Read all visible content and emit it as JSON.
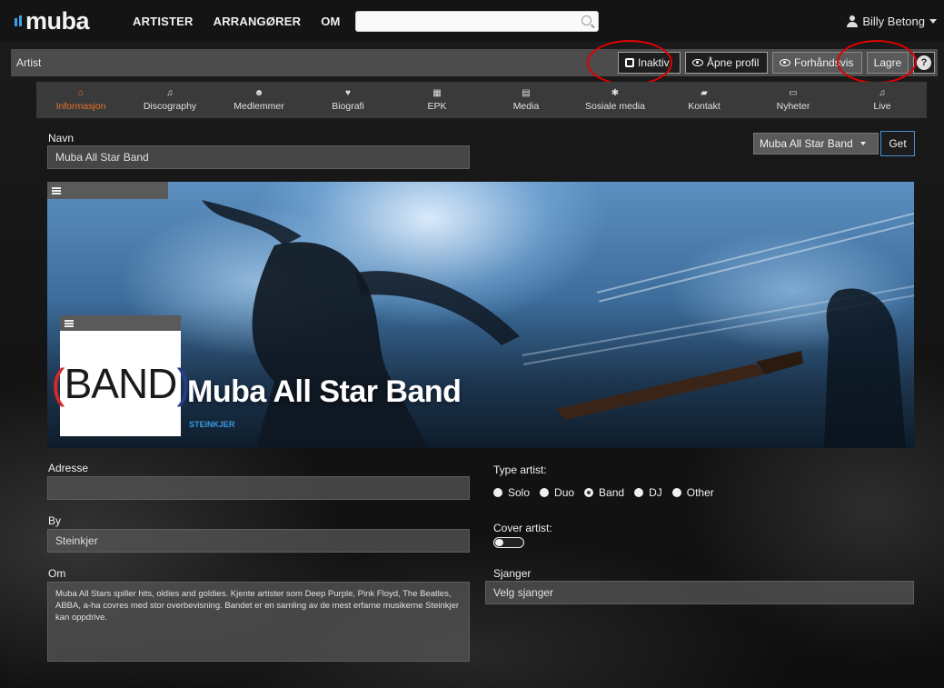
{
  "nav": {
    "logo": "muba",
    "links": [
      "ARTISTER",
      "ARRANGØRER",
      "OM"
    ],
    "search_placeholder": "",
    "user": "Billy Betong"
  },
  "header": {
    "title": "Artist",
    "actions": {
      "inactive": "Inaktiv",
      "open_profile": "Åpne profil",
      "preview": "Forhåndsvis",
      "save": "Lagre",
      "help": "?"
    }
  },
  "tabs": [
    {
      "label": "Informasjon",
      "icon": "home-icon",
      "glyph": "⌂",
      "active": true
    },
    {
      "label": "Discography",
      "icon": "music-icon",
      "glyph": "♫"
    },
    {
      "label": "Medlemmer",
      "icon": "users-icon",
      "glyph": "☻"
    },
    {
      "label": "Biografi",
      "icon": "heart-icon",
      "glyph": "♥"
    },
    {
      "label": "EPK",
      "icon": "calendar-icon",
      "glyph": "▦"
    },
    {
      "label": "Media",
      "icon": "file-icon",
      "glyph": "▤"
    },
    {
      "label": "Sosiale media",
      "icon": "gear-icon",
      "glyph": "✱"
    },
    {
      "label": "Kontakt",
      "icon": "book-icon",
      "glyph": "▰"
    },
    {
      "label": "Nyheter",
      "icon": "newspaper-icon",
      "glyph": "▭"
    },
    {
      "label": "Live",
      "icon": "music-icon",
      "glyph": "♫"
    }
  ],
  "form": {
    "name_label": "Navn",
    "name_value": "Muba All Star Band",
    "artist_select": "Muba All Star Band",
    "get_button": "Get",
    "address_label": "Adresse",
    "address_value": "",
    "city_label": "By",
    "city_value": "Steinkjer",
    "about_label": "Om",
    "about_value": "Muba All Stars spiller hits, oldies and goldies. Kjente artister som Deep Purple, Pink Floyd, The Beatles, ABBA, a-ha covres med stor overbevisning. Bandet er en samling av de mest erfarne musikerne Steinkjer kan oppdrive.",
    "type_label": "Type artist:",
    "types": [
      {
        "label": "Solo",
        "checked": false
      },
      {
        "label": "Duo",
        "checked": false
      },
      {
        "label": "Band",
        "checked": true
      },
      {
        "label": "DJ",
        "checked": false
      },
      {
        "label": "Other",
        "checked": false
      }
    ],
    "cover_label": "Cover artist:",
    "cover_on": false,
    "genre_label": "Sjanger",
    "genre_value": "Velg sjanger"
  },
  "banner": {
    "band_name": "Muba All Star Band",
    "location": "STEINKJER",
    "logo_text": [
      "(",
      "BAND",
      ")"
    ]
  },
  "colors": {
    "accent": "#e8732a",
    "link_blue": "#3a9ae0",
    "highlight_ring": "#e00000"
  }
}
